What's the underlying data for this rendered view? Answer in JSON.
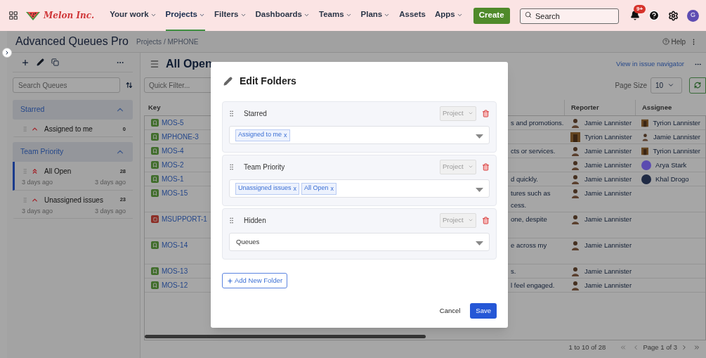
{
  "nav": {
    "logo": "Melon Inc.",
    "items": [
      {
        "label": "Your work",
        "dropdown": true,
        "selected": false
      },
      {
        "label": "Projects",
        "dropdown": true,
        "selected": true
      },
      {
        "label": "Filters",
        "dropdown": true,
        "selected": false
      },
      {
        "label": "Dashboards",
        "dropdown": true,
        "selected": false
      },
      {
        "label": "Teams",
        "dropdown": true,
        "selected": false
      },
      {
        "label": "Plans",
        "dropdown": true,
        "selected": false
      },
      {
        "label": "Assets",
        "dropdown": false,
        "selected": false
      },
      {
        "label": "Apps",
        "dropdown": true,
        "selected": false
      }
    ],
    "create": "Create",
    "search": {
      "placeholder": "Search"
    },
    "notifications_badge": "9+",
    "avatar": "G"
  },
  "header": {
    "title": "Advanced Queues Pro",
    "breadcrumb": "Projects / MPHONE",
    "help": "Help"
  },
  "sidebar": {
    "search": {
      "placeholder": "Search Queues"
    },
    "folders": [
      {
        "name": "Starred",
        "expanded": true,
        "queues": [
          {
            "name": "Assigned to me",
            "count": "0",
            "kind": "high",
            "selected": false
          }
        ]
      },
      {
        "name": "Team Priority",
        "expanded": true,
        "queues": [
          {
            "name": "All Open",
            "count": "28",
            "kind": "highest",
            "selected": true,
            "created": "3 days ago",
            "updated": "3 days ago"
          },
          {
            "name": "Unassigned issues",
            "count": "23",
            "kind": "high",
            "selected": false,
            "created": "3 days ago",
            "updated": "3 days ago"
          }
        ]
      }
    ]
  },
  "main": {
    "title": "All Open",
    "quick_filter": {
      "placeholder": "Quick Filter..."
    },
    "navigator_link": "View in issue navigator",
    "page_size_label": "Page Size",
    "page_size": "10",
    "columns": [
      "Key",
      "Reporter",
      "Assignee"
    ],
    "rows": [
      {
        "key": "MOS-5",
        "kind": "story",
        "summary": [
          "s and promotions."
        ],
        "reporter": {
          "name": "Jamie Lannister",
          "kind": "figure"
        },
        "assignee": {
          "name": "Tyrion Lannister",
          "kind": "portrait"
        }
      },
      {
        "key": "MPHONE-3",
        "kind": "story",
        "reporter": {
          "name": "Tyrion Lannister",
          "kind": "portrait"
        },
        "assignee": {
          "name": "Jamie Lannister",
          "kind": "figure"
        }
      },
      {
        "key": "MOS-4",
        "kind": "story",
        "summary": [
          "cts or services."
        ],
        "reporter": {
          "name": "Jamie Lannister",
          "kind": "figure"
        },
        "assignee": {
          "name": "Tyrion Lannister",
          "kind": "portrait"
        }
      },
      {
        "key": "MOS-2",
        "kind": "story",
        "reporter": {
          "name": "Jamie Lannister",
          "kind": "figure"
        },
        "assignee": {
          "name": "Arya Stark",
          "kind": "initials",
          "color": "#5b4bb0"
        }
      },
      {
        "key": "MOS-1",
        "kind": "story",
        "summary": [
          "d quickly."
        ],
        "reporter": {
          "name": "Jamie Lannister",
          "kind": "figure"
        },
        "assignee": {
          "name": "Khal Drogo",
          "kind": "initials",
          "color": "#1f2a44"
        }
      },
      {
        "key": "MOS-15",
        "kind": "story",
        "summary": [
          "tures such as",
          "cess."
        ],
        "reporter": {
          "name": "Jamie Lannister",
          "kind": "figure"
        }
      },
      {
        "key": "MSUPPORT-1",
        "kind": "support",
        "summary": [
          "one, despite"
        ],
        "reporter": {
          "name": "Jamie Lannister",
          "kind": "figure"
        }
      },
      {
        "key": "MOS-14",
        "kind": "story",
        "summary": [
          "e across my"
        ],
        "reporter": {
          "name": "Jamie Lannister",
          "kind": "figure"
        }
      },
      {
        "key": "MOS-13",
        "kind": "story",
        "summary": [
          "s."
        ],
        "reporter": {
          "name": "Jamie Lannister",
          "kind": "figure"
        }
      },
      {
        "key": "MOS-12",
        "kind": "story",
        "summary": [
          "l feel engaged."
        ],
        "reporter": {
          "name": "Jamie Lannister",
          "kind": "figure"
        }
      }
    ],
    "pagination": {
      "range": "1 to 10 of 28",
      "page": "Page 1 of 3"
    }
  },
  "dialog": {
    "title": "Edit Folders",
    "folders": [
      {
        "name": "Starred",
        "scope": "Project",
        "queues": [
          {
            "label": "Assigned to me",
            "remove": "x"
          }
        ]
      },
      {
        "name": "Team Priority",
        "scope": "Project",
        "queues": [
          {
            "label": "Unassigned issues",
            "remove": "x"
          },
          {
            "label": "All Open",
            "remove": "x"
          }
        ]
      },
      {
        "name": "Hidden",
        "scope": "Project",
        "placeholder": "Queues"
      }
    ],
    "add_button": "Add New Folder",
    "cancel": "Cancel",
    "save": "Save"
  }
}
